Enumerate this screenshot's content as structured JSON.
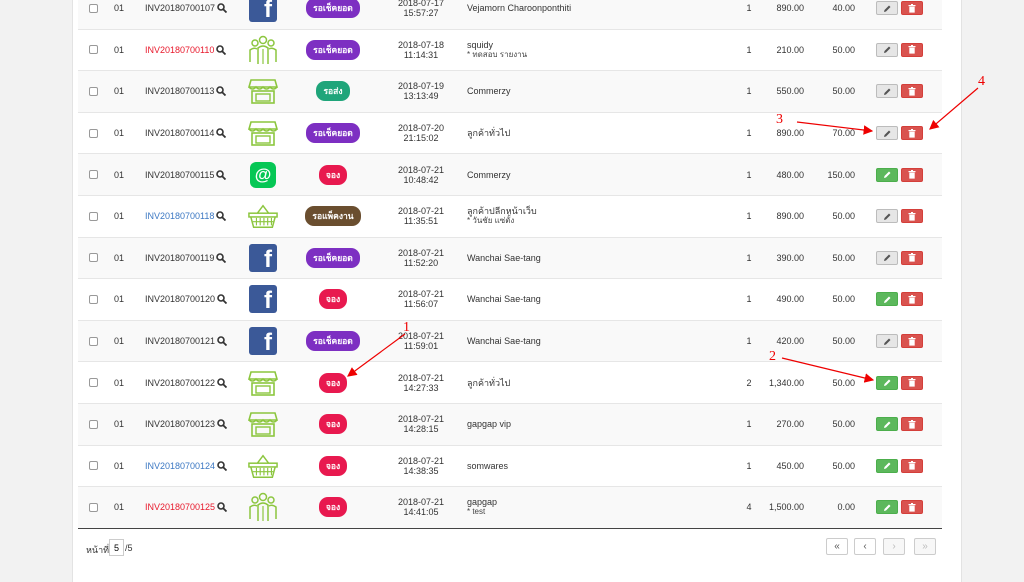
{
  "colors": {
    "badge_purple": "#7d2fc2",
    "badge_teal": "#1fa57a",
    "badge_pink": "#e8194f",
    "badge_brown": "#6a4e2f",
    "shop_green": "#8cc63f",
    "annotation_red": "#e00000"
  },
  "rows": [
    {
      "no": "01",
      "inv": "INV20180700107",
      "inv_style": "dark",
      "icon": "facebook-icon",
      "status": "รอเช็คยอด",
      "status_color": "#7d2fc2",
      "date": "2018-07-17",
      "time": "15:57:27",
      "customer": "Vejamorn Charoonponthiti",
      "note": "",
      "qty": "1",
      "amount": "890.00",
      "shipping": "40.00",
      "edit_color": "grey"
    },
    {
      "no": "01",
      "inv": "INV20180700110",
      "inv_style": "red",
      "icon": "people-icon",
      "status": "รอเช็คยอด",
      "status_color": "#7d2fc2",
      "date": "2018-07-18",
      "time": "11:14:31",
      "customer": "squidy",
      "note": "* ทดสอบ รายงาน",
      "qty": "1",
      "amount": "210.00",
      "shipping": "50.00",
      "edit_color": "grey"
    },
    {
      "no": "01",
      "inv": "INV20180700113",
      "inv_style": "dark",
      "icon": "shop-icon",
      "status": "รอส่ง",
      "status_color": "#1fa57a",
      "date": "2018-07-19",
      "time": "13:13:49",
      "customer": "Commerzy",
      "note": "",
      "qty": "1",
      "amount": "550.00",
      "shipping": "50.00",
      "edit_color": "grey"
    },
    {
      "no": "01",
      "inv": "INV20180700114",
      "inv_style": "dark",
      "icon": "shop-icon",
      "status": "รอเช็คยอด",
      "status_color": "#7d2fc2",
      "date": "2018-07-20",
      "time": "21:15:02",
      "customer": "ลูกค้าทั่วไป",
      "note": "",
      "qty": "1",
      "amount": "890.00",
      "shipping": "70.00",
      "edit_color": "grey"
    },
    {
      "no": "01",
      "inv": "INV20180700115",
      "inv_style": "dark",
      "icon": "line-icon",
      "status": "จอง",
      "status_color": "#e8194f",
      "date": "2018-07-21",
      "time": "10:48:42",
      "customer": "Commerzy",
      "note": "",
      "qty": "1",
      "amount": "480.00",
      "shipping": "150.00",
      "edit_color": "green"
    },
    {
      "no": "01",
      "inv": "INV20180700118",
      "inv_style": "blue",
      "icon": "basket-icon",
      "status": "รอแพ็คงาน",
      "status_color": "#6a4e2f",
      "date": "2018-07-21",
      "time": "11:35:51",
      "customer": "ลูกค้าปลีกหน้าเว็บ",
      "note": "* วันชัย แซ่ตั้ง",
      "qty": "1",
      "amount": "890.00",
      "shipping": "50.00",
      "edit_color": "grey"
    },
    {
      "no": "01",
      "inv": "INV20180700119",
      "inv_style": "dark",
      "icon": "facebook-icon",
      "status": "รอเช็คยอด",
      "status_color": "#7d2fc2",
      "date": "2018-07-21",
      "time": "11:52:20",
      "customer": "Wanchai Sae-tang",
      "note": "",
      "qty": "1",
      "amount": "390.00",
      "shipping": "50.00",
      "edit_color": "grey"
    },
    {
      "no": "01",
      "inv": "INV20180700120",
      "inv_style": "dark",
      "icon": "facebook-icon",
      "status": "จอง",
      "status_color": "#e8194f",
      "date": "2018-07-21",
      "time": "11:56:07",
      "customer": "Wanchai Sae-tang",
      "note": "",
      "qty": "1",
      "amount": "490.00",
      "shipping": "50.00",
      "edit_color": "green"
    },
    {
      "no": "01",
      "inv": "INV20180700121",
      "inv_style": "dark",
      "icon": "facebook-icon",
      "status": "รอเช็คยอด",
      "status_color": "#7d2fc2",
      "date": "2018-07-21",
      "time": "11:59:01",
      "customer": "Wanchai Sae-tang",
      "note": "",
      "qty": "1",
      "amount": "420.00",
      "shipping": "50.00",
      "edit_color": "grey"
    },
    {
      "no": "01",
      "inv": "INV20180700122",
      "inv_style": "dark",
      "icon": "shop-icon",
      "status": "จอง",
      "status_color": "#e8194f",
      "date": "2018-07-21",
      "time": "14:27:33",
      "customer": "ลูกค้าทั่วไป",
      "note": "",
      "qty": "2",
      "amount": "1,340.00",
      "shipping": "50.00",
      "edit_color": "green"
    },
    {
      "no": "01",
      "inv": "INV20180700123",
      "inv_style": "dark",
      "icon": "shop-icon",
      "status": "จอง",
      "status_color": "#e8194f",
      "date": "2018-07-21",
      "time": "14:28:15",
      "customer": "gapgap vip",
      "note": "",
      "qty": "1",
      "amount": "270.00",
      "shipping": "50.00",
      "edit_color": "green"
    },
    {
      "no": "01",
      "inv": "INV20180700124",
      "inv_style": "blue",
      "icon": "basket-icon",
      "status": "จอง",
      "status_color": "#e8194f",
      "date": "2018-07-21",
      "time": "14:38:35",
      "customer": "somwares",
      "note": "",
      "qty": "1",
      "amount": "450.00",
      "shipping": "50.00",
      "edit_color": "green"
    },
    {
      "no": "01",
      "inv": "INV20180700125",
      "inv_style": "red",
      "icon": "people-icon",
      "status": "จอง",
      "status_color": "#e8194f",
      "date": "2018-07-21",
      "time": "14:41:05",
      "customer": "gapgap",
      "note": "* test",
      "qty": "4",
      "amount": "1,500.00",
      "shipping": "0.00",
      "edit_color": "green"
    }
  ],
  "pagination": {
    "label": "หน้าที่",
    "current": "5",
    "total": "/5",
    "first": "«",
    "prev": "‹",
    "next": "›",
    "last": "»"
  },
  "annotations": {
    "a1": "1",
    "a2": "2",
    "a3": "3",
    "a4": "4"
  }
}
